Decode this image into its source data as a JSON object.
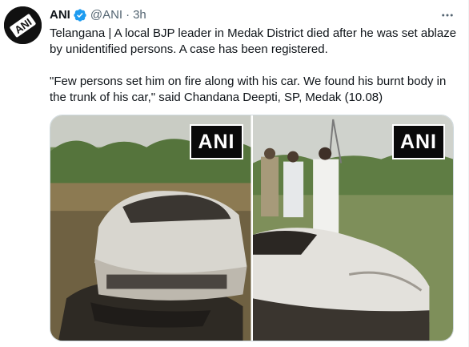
{
  "account": {
    "name": "ANI",
    "handle": "@ANI",
    "separator": "·",
    "time": "3h",
    "avatar_text": "ANI"
  },
  "tweet": {
    "paragraph1": "Telangana | A local BJP leader in Medak District died after he was set ablaze by unidentified persons. A case has been registered.",
    "paragraph2": "\"Few persons set him on fire along with his car. We found his burnt body in the trunk of his car,\" said Chandana Deepti, SP, Medak (10.08)"
  },
  "media": {
    "photos": [
      {
        "watermark": "ANI"
      },
      {
        "watermark": "ANI"
      }
    ]
  },
  "icons": {
    "verified": "verified-badge-icon",
    "more": "more-options-icon"
  },
  "colors": {
    "verified_blue": "#1d9bf0",
    "secondary_text": "#536471",
    "primary_text": "#0f1419"
  }
}
